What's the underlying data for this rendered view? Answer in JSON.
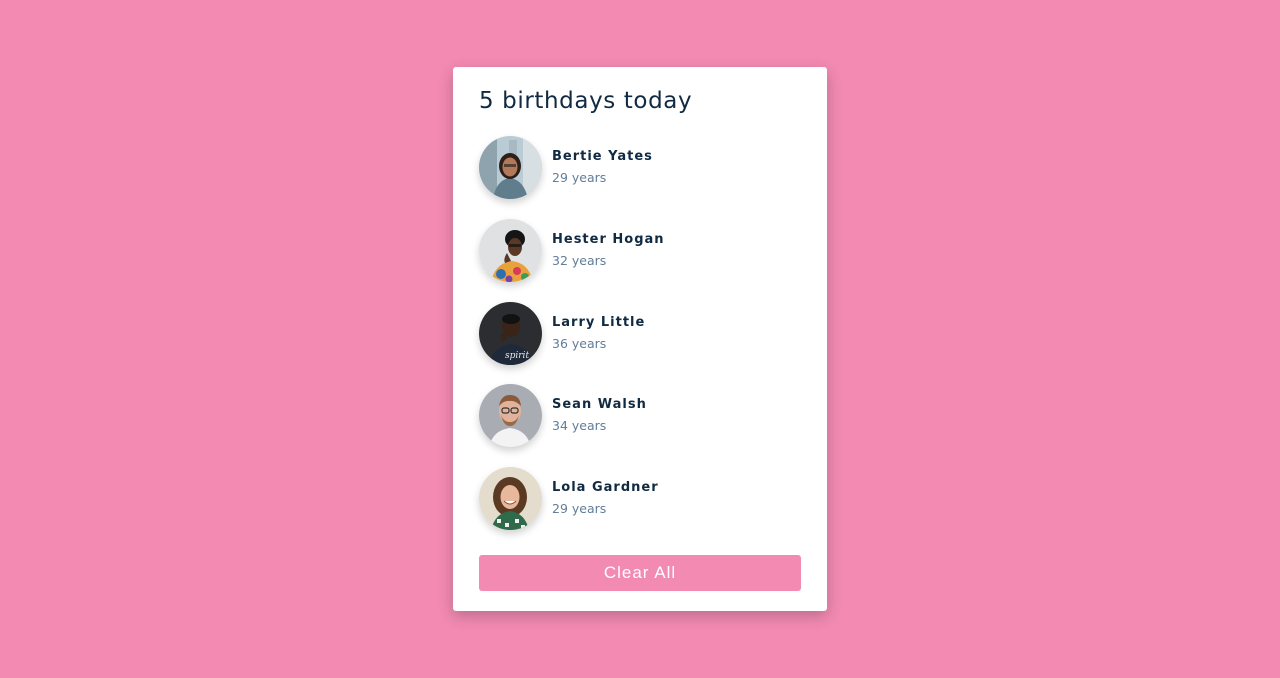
{
  "header": {
    "title": "5 birthdays today"
  },
  "people": [
    {
      "name": "Bertie Yates",
      "age": "29 years",
      "avatar_icon": "woman-photo-avatar"
    },
    {
      "name": "Hester Hogan",
      "age": "32 years",
      "avatar_icon": "woman-photo-avatar"
    },
    {
      "name": "Larry Little",
      "age": "36 years",
      "avatar_icon": "man-photo-avatar"
    },
    {
      "name": "Sean Walsh",
      "age": "34 years",
      "avatar_icon": "man-photo-avatar"
    },
    {
      "name": "Lola Gardner",
      "age": "29 years",
      "avatar_icon": "woman-photo-avatar"
    }
  ],
  "actions": {
    "clear_label": "Clear All"
  },
  "colors": {
    "background": "#f28ab2",
    "card": "#ffffff",
    "heading": "#102a42",
    "subtext": "#617d98",
    "button": "#f28ab2"
  }
}
